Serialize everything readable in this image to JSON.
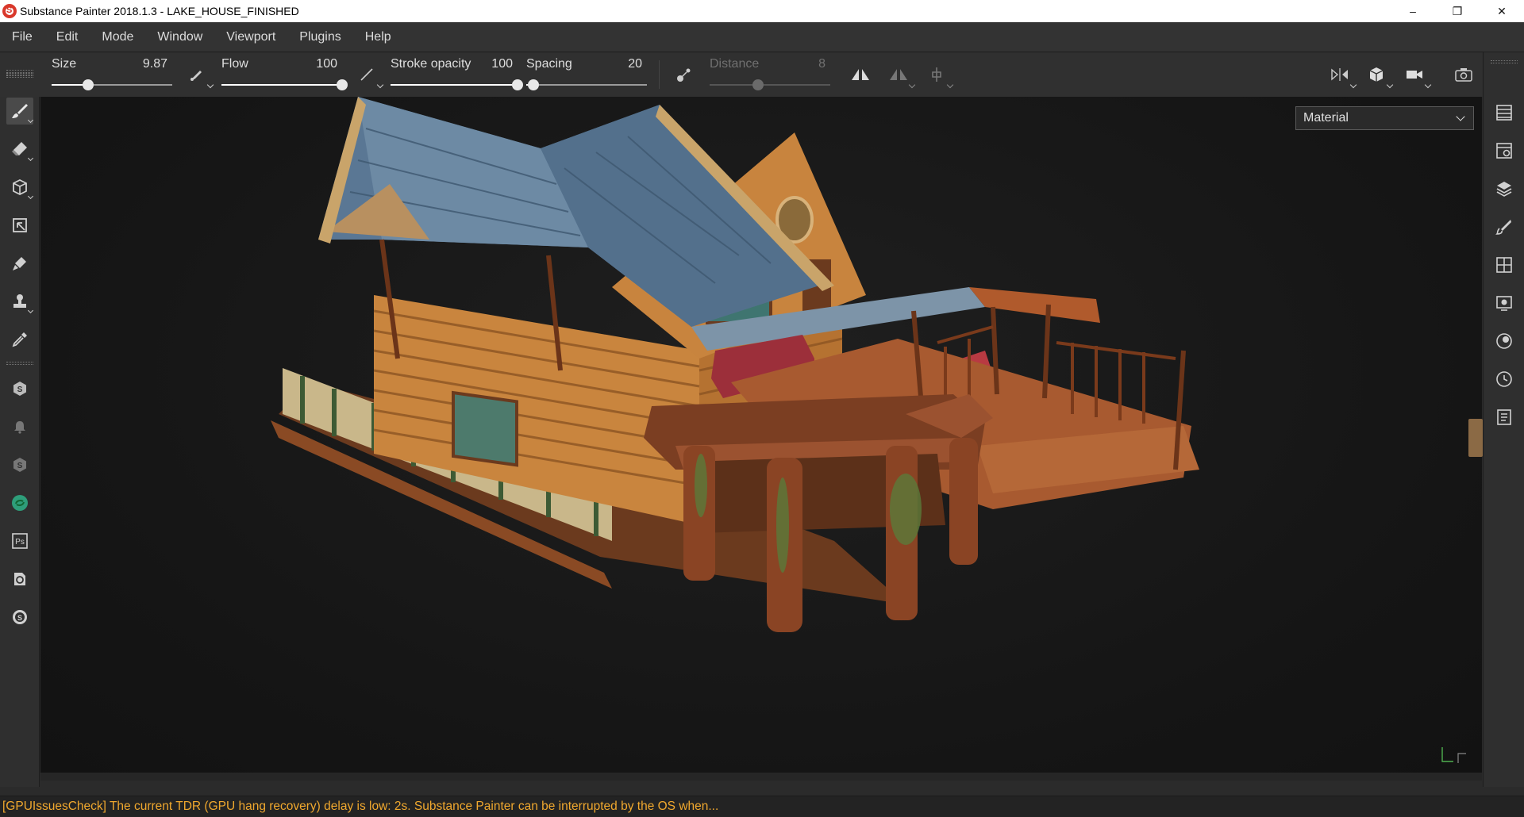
{
  "window": {
    "title": "Substance Painter 2018.1.3 - LAKE_HOUSE_FINISHED",
    "controls": [
      "–",
      "❐",
      "✕"
    ]
  },
  "menu": [
    "File",
    "Edit",
    "Mode",
    "Window",
    "Viewport",
    "Plugins",
    "Help"
  ],
  "toolbar": {
    "size": {
      "label": "Size",
      "value": "9.87",
      "fraction": 0.3
    },
    "flow": {
      "label": "Flow",
      "value": "100",
      "fraction": 1.0
    },
    "stroke_opacity": {
      "label": "Stroke opacity",
      "value": "100",
      "fraction": 1.0
    },
    "spacing": {
      "label": "Spacing",
      "value": "20",
      "fraction": 0.06
    },
    "distance": {
      "label": "Distance",
      "value": "8",
      "fraction": 0.4,
      "enabled": false
    }
  },
  "left_tools": [
    "paint-brush-icon",
    "eraser-icon",
    "projection-icon",
    "polygon-fill-icon",
    "smudge-icon",
    "clone-stamp-icon",
    "color-picker-icon",
    "substance-share-icon",
    "notification-bell-icon",
    "substance-source-icon",
    "live-link-icon",
    "photoshop-export-icon",
    "bake-refresh-icon",
    "iray-icon"
  ],
  "right_dock": [
    "layers-list-icon",
    "texture-set-settings-icon",
    "stack-icon",
    "brush-properties-icon",
    "uv-grid-icon",
    "display-settings-icon",
    "viewer-settings-icon",
    "history-icon",
    "log-icon"
  ],
  "viewport": {
    "mode_selector": "Material",
    "model": "3D log cabin lake house with deck and porch"
  },
  "status": {
    "message": "[GPUIssuesCheck] The current TDR (GPU hang recovery) delay is low: 2s. Substance Painter can be interrupted by the OS when...",
    "color": "#f0a82e"
  },
  "colors": {
    "background": "#2b2b2b",
    "viewport": "#171717",
    "warning": "#f0a82e",
    "app_icon": "#d9382b"
  }
}
